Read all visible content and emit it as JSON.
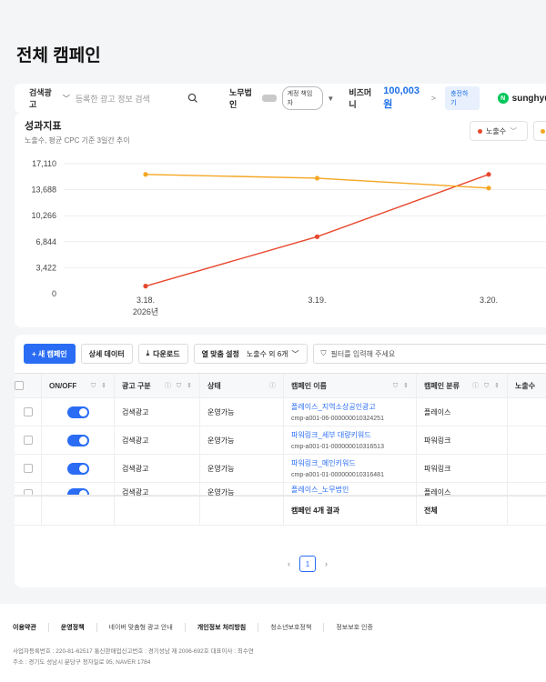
{
  "page": {
    "title": "전체 캠페인"
  },
  "topbar": {
    "ad_type": "검색광고",
    "search_placeholder": "등록한 광고 정보 검색",
    "account": "노무법인",
    "role": "계정 책임자",
    "bizmoney_label": "비즈머니",
    "bizmoney_value": "100,003원",
    "charge_label": "충전하기",
    "username": "sunghyuby"
  },
  "chart_card": {
    "title": "성과지표",
    "subtitle": "노출수, 평균 CPC 기준 3일간 추이",
    "legend_label": "노출수"
  },
  "chart_data": {
    "type": "line",
    "x": [
      "3.18.",
      "3.19.",
      "3.20."
    ],
    "x_sub": [
      "2026년",
      "",
      ""
    ],
    "y_ticks": [
      "0",
      "3,422",
      "6,844",
      "10,266",
      "13,688",
      "17,110"
    ],
    "ylim": [
      0,
      17110
    ],
    "series": [
      {
        "name": "노출수",
        "color": "#e8472e",
        "values": [
          1000,
          7500,
          15700
        ]
      },
      {
        "name": "",
        "color": "#f5a623",
        "values": [
          15700,
          15200,
          13900
        ]
      }
    ]
  },
  "toolbar": {
    "new_campaign": "+ 새 캠페인",
    "detail_data": "상세 데이터",
    "download": "다운로드",
    "column_settings": "열 맞춤 설정",
    "column_value": "노출수 외 6개",
    "filter_placeholder": "필터를 입력해 주세요"
  },
  "table": {
    "headers": [
      "ON/OFF",
      "광고 구분",
      "상태",
      "캠페인 이름",
      "캠페인 분류",
      "노출수"
    ],
    "rows": [
      {
        "type": "검색광고",
        "status": "운영가능",
        "name": "플레이스_지역소상공인광고",
        "id": "cmp-a001-06-000000010324251",
        "category": "플레이스"
      },
      {
        "type": "검색광고",
        "status": "운영가능",
        "name": "파워링크_세부 대량키워드",
        "id": "cmp-a001-01-000000010316513",
        "category": "파워링크"
      },
      {
        "type": "검색광고",
        "status": "운영가능",
        "name": "파워링크_메인키워드",
        "id": "cmp-a001-01-000000010316481",
        "category": "파워링크"
      },
      {
        "type": "검색광고",
        "status": "운영가능",
        "name": "플레이스_노무법인",
        "id": "",
        "category": "플레이스"
      }
    ],
    "summary_label": "캠페인 4개 결과",
    "summary_total": "전체"
  },
  "pager": {
    "current": "1",
    "prev": "‹",
    "next": "›"
  },
  "footer": {
    "links": [
      "이용약관",
      "운영정책",
      "네이버 맞춤형 광고 안내",
      "개인정보 처리방침",
      "청소년보호정책",
      "정보보호 인증"
    ],
    "info_line1": "사업자등록번호 : 220-81-62517    통신판매업신고번호 : 경기성남 제 2006-692호    대표이사 : 최수연",
    "info_line2": "주소 : 경기도 성남시 분당구 정자일로 95, NAVER 1784"
  },
  "colors": {
    "accent": "#2a6df4",
    "series_red": "#e8472e",
    "series_orange": "#f5a623",
    "naver_green": "#03c75a"
  }
}
